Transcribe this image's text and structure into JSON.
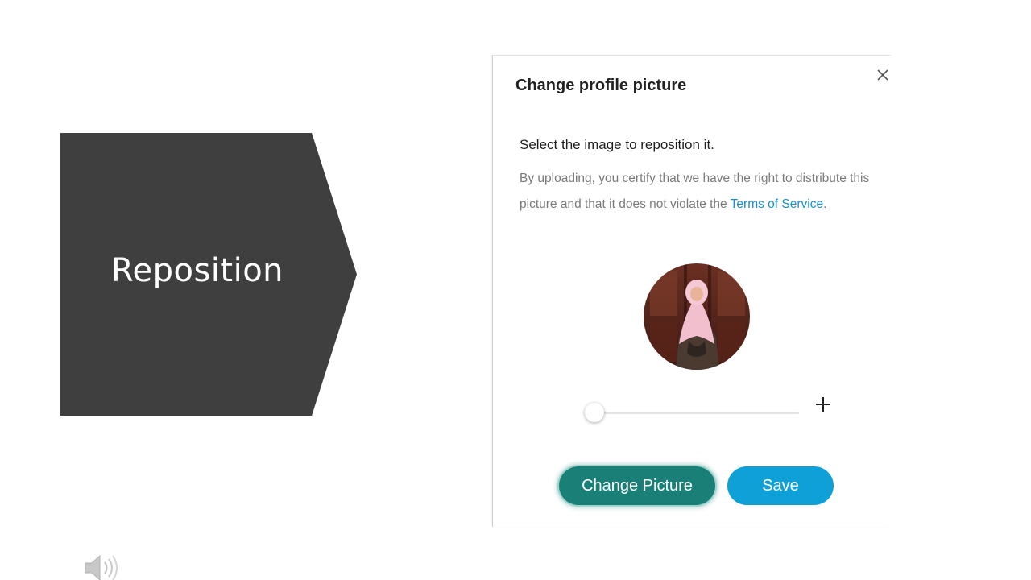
{
  "slide": {
    "heading": "Reposition"
  },
  "dialog": {
    "title": "Change profile picture",
    "instruction": "Select the image to reposition it.",
    "disclaimer_text": "By uploading, you certify that we have the right to distribute this picture and that it does not violate the ",
    "terms_link": "Terms of Service",
    "disclaimer_end": ".",
    "zoom_level": 0,
    "buttons": {
      "change_picture": "Change Picture",
      "save": "Save"
    }
  },
  "icons": {
    "close": "close-icon",
    "zoom_in": "plus-icon",
    "audio": "speaker-icon"
  },
  "colors": {
    "slide_shape": "#3f3f3f",
    "change_button": "#1a7f76",
    "save_button": "#0fa0d8",
    "link": "#1a8fd1"
  }
}
